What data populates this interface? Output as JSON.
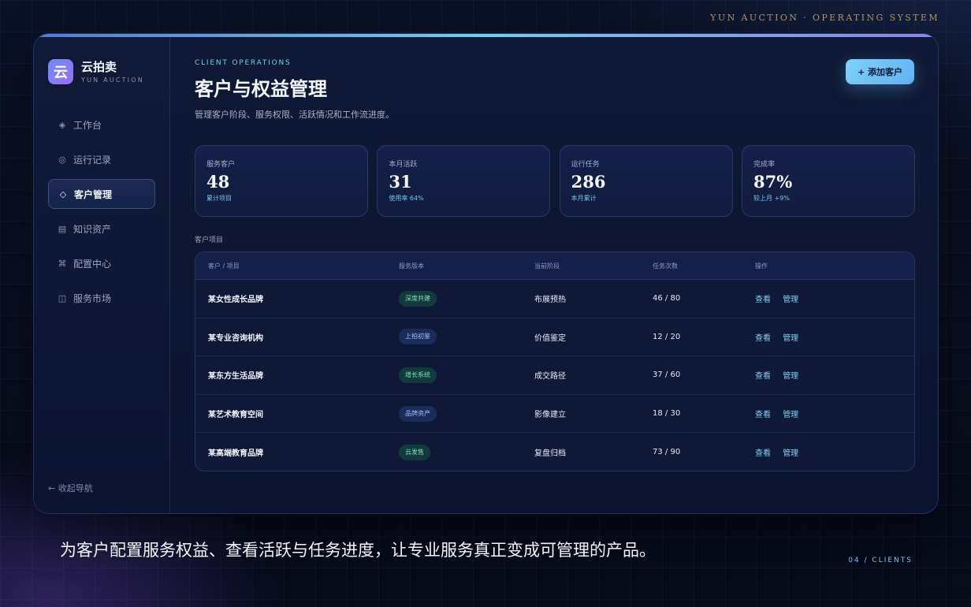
{
  "os_label": "YUN AUCTION · OPERATING SYSTEM",
  "brand": {
    "logo": "云",
    "name": "云拍卖",
    "sub": "YUN AUCTION"
  },
  "nav": [
    {
      "icon": "◈",
      "label": "工作台"
    },
    {
      "icon": "◎",
      "label": "运行记录"
    },
    {
      "icon": "◇",
      "label": "客户管理"
    },
    {
      "icon": "▤",
      "label": "知识资产"
    },
    {
      "icon": "⌘",
      "label": "配置中心"
    },
    {
      "icon": "◫",
      "label": "服务市场"
    }
  ],
  "collapse_label": "← 收起导航",
  "header": {
    "eyebrow": "CLIENT OPERATIONS",
    "title": "客户与权益管理",
    "desc": "管理客户阶段、服务权限、活跃情况和工作流进度。",
    "add_button": "+ 添加客户"
  },
  "stats": [
    {
      "label": "服务客户",
      "value": "48",
      "note": "累计项目"
    },
    {
      "label": "本月活跃",
      "value": "31",
      "note": "使用率 64%"
    },
    {
      "label": "运行任务",
      "value": "286",
      "note": "本月累计"
    },
    {
      "label": "完成率",
      "value": "87%",
      "note": "较上月 +9%"
    }
  ],
  "section_label": "客户项目",
  "table": {
    "headers": [
      "客户 / 项目",
      "服务版本",
      "当前阶段",
      "任务次数",
      "操作"
    ],
    "rows": [
      {
        "name": "某女性成长品牌",
        "version": "深度共建",
        "stage": "布展预热",
        "tasks": "46 / 80"
      },
      {
        "name": "某专业咨询机构",
        "version": "上拍初鉴",
        "stage": "价值鉴定",
        "tasks": "12 / 20"
      },
      {
        "name": "某东方生活品牌",
        "version": "增长系统",
        "stage": "成交路径",
        "tasks": "37 / 60"
      },
      {
        "name": "某艺术教育空间",
        "version": "品牌资产",
        "stage": "影像建立",
        "tasks": "18 / 30"
      },
      {
        "name": "某高端教育品牌",
        "version": "云发售",
        "stage": "复盘归档",
        "tasks": "73 / 90"
      }
    ],
    "action_view": "查看",
    "action_manage": "管理"
  },
  "caption": "为客户配置服务权益、查看活跃与任务进度，让专业服务真正变成可管理的产品。",
  "page_num": "04 / CLIENTS",
  "colors": {
    "accent": "#6fd0f0",
    "bg": "#080d1e",
    "tag_green": "#7de0b8",
    "tag_blue": "#9fc0f6"
  }
}
